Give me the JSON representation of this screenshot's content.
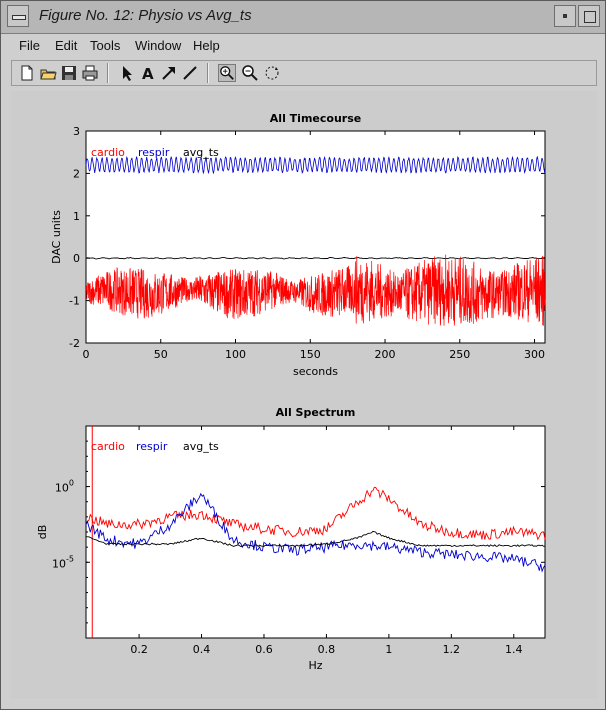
{
  "window": {
    "title": "Figure No. 12: Physio vs Avg_ts",
    "menu": [
      "File",
      "Edit",
      "Tools",
      "Window",
      "Help"
    ],
    "toolbar_icons": [
      "new-file-icon",
      "open-folder-icon",
      "save-icon",
      "print-icon",
      "arrow-select-icon",
      "text-tool-icon",
      "arrow-tool-icon",
      "line-tool-icon",
      "zoom-in-icon",
      "zoom-out-icon",
      "rotate-icon"
    ]
  },
  "colors": {
    "cardio": "#ff0000",
    "respir": "#0000cc",
    "avg_ts": "#000000"
  },
  "chart_data": [
    {
      "type": "line",
      "title": "All Timecourse",
      "xlabel": "seconds",
      "ylabel": "DAC units",
      "xlim": [
        0,
        307
      ],
      "ylim": [
        -2,
        3
      ],
      "xticks": [
        "0",
        "50",
        "100",
        "150",
        "200",
        "250",
        "300"
      ],
      "yticks": [
        "-2",
        "-1",
        "0",
        "1",
        "2",
        "3"
      ],
      "legend": [
        "cardio",
        "respir",
        "avg_ts"
      ],
      "legend_position": "top-left",
      "series": [
        {
          "name": "respir",
          "baseline": 2.2,
          "amplitude": 0.18
        },
        {
          "name": "avg_ts",
          "baseline": 0.0,
          "amplitude": 0.02
        },
        {
          "name": "cardio",
          "baseline": -0.8,
          "amplitude": 0.45
        }
      ]
    },
    {
      "type": "line",
      "title": "All Spectrum",
      "xlabel": "Hz",
      "ylabel": "dB",
      "xlim": [
        0.03,
        1.5
      ],
      "ylim_log10": [
        -10,
        4
      ],
      "log_y": true,
      "xticks": [
        "0.2",
        "0.4",
        "0.6",
        "0.8",
        "1",
        "1.2",
        "1.4"
      ],
      "yticks": [
        "10^0",
        "10^-5"
      ],
      "legend": [
        "cardio",
        "respir",
        "avg_ts"
      ],
      "legend_position": "top-left",
      "vertical_marker_x": 0.05,
      "series": [
        {
          "name": "cardio",
          "x": [
            0.03,
            0.1,
            0.2,
            0.3,
            0.4,
            0.5,
            0.6,
            0.7,
            0.8,
            0.9,
            0.95,
            1.0,
            1.1,
            1.2,
            1.3,
            1.4,
            1.5
          ],
          "log10_y": [
            -2,
            -2.5,
            -2.5,
            -2.0,
            -1.8,
            -2.5,
            -2.8,
            -3.0,
            -2.8,
            -1.0,
            -0.2,
            -0.8,
            -2.5,
            -3.0,
            -3.2,
            -3.0,
            -3.2
          ]
        },
        {
          "name": "respir",
          "x": [
            0.03,
            0.1,
            0.2,
            0.3,
            0.35,
            0.4,
            0.45,
            0.5,
            0.6,
            0.7,
            0.8,
            0.9,
            1.0,
            1.1,
            1.2,
            1.3,
            1.4,
            1.5
          ],
          "log10_y": [
            -2.5,
            -3.5,
            -3.8,
            -2.5,
            -1.5,
            -0.5,
            -2.0,
            -3.5,
            -4.0,
            -4.2,
            -4.0,
            -3.8,
            -4.0,
            -4.3,
            -4.5,
            -4.6,
            -4.8,
            -5.3
          ]
        },
        {
          "name": "avg_ts",
          "x": [
            0.03,
            0.1,
            0.2,
            0.3,
            0.4,
            0.5,
            0.6,
            0.7,
            0.8,
            0.9,
            0.95,
            1.0,
            1.1,
            1.2,
            1.3,
            1.4,
            1.5
          ],
          "log10_y": [
            -3.3,
            -3.8,
            -3.8,
            -3.8,
            -3.4,
            -3.9,
            -3.9,
            -3.9,
            -3.8,
            -3.4,
            -3.0,
            -3.4,
            -3.9,
            -3.9,
            -3.9,
            -3.9,
            -3.9
          ]
        }
      ]
    }
  ]
}
